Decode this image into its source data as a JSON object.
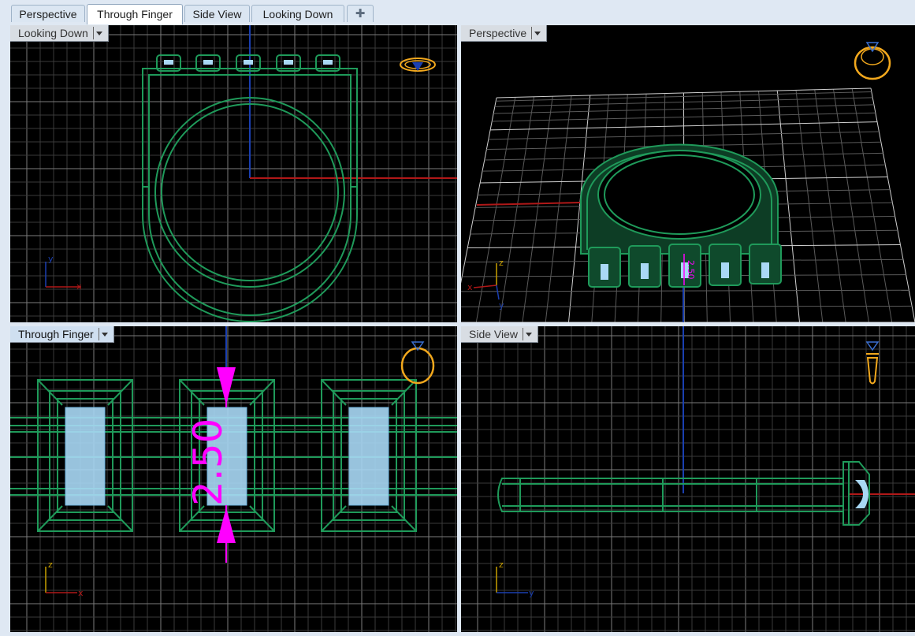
{
  "tabs": [
    {
      "label": "Perspective",
      "active": false
    },
    {
      "label": "Through Finger",
      "active": true
    },
    {
      "label": "Side View",
      "active": false
    },
    {
      "label": "Looking Down",
      "active": false
    }
  ],
  "add_tab_icon": "plus-icon",
  "viewports": {
    "top_left": {
      "label": "Looking Down",
      "axes": [
        "y",
        "x"
      ]
    },
    "top_right": {
      "label": "Perspective",
      "axes": [
        "z",
        "x",
        "y"
      ]
    },
    "bottom_left": {
      "label": "Through Finger",
      "axes": [
        "z",
        "x"
      ]
    },
    "bottom_right": {
      "label": "Side View",
      "axes": [
        "z",
        "y"
      ]
    }
  },
  "dimensions": {
    "stone_height": "2.50",
    "perspective_dim": "2.50"
  },
  "colors": {
    "background": "#000000",
    "grid_minor": "#3a3a3a",
    "grid_major": "#8a8a8a",
    "model_wire": "#1f9a5a",
    "stone": "#a9d8f5",
    "dimension": "#ff00ff",
    "x_axis": "#b01818",
    "y_axis": "#1a3fb0",
    "z_axis": "#c8a000",
    "nav_icon": "#f2a81d",
    "tab_bar": "#dfe8f3"
  }
}
